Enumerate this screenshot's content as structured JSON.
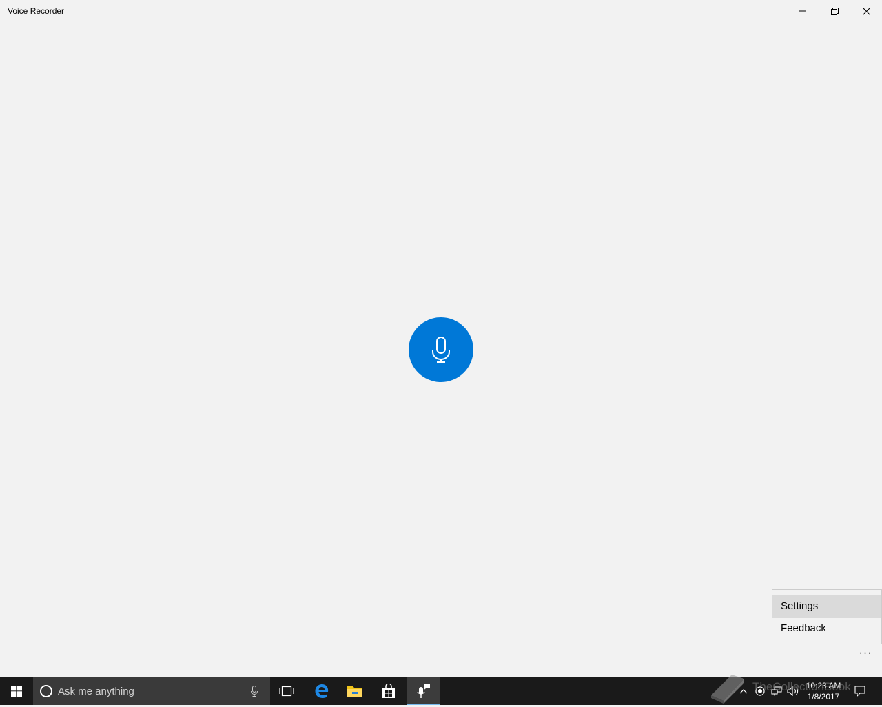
{
  "app": {
    "title": "Voice Recorder"
  },
  "window_controls": {
    "minimize": "minimize-icon",
    "maximize": "restore-icon",
    "close": "close-icon"
  },
  "record": {
    "icon": "microphone-icon",
    "accent": "#0078d7"
  },
  "menu": {
    "items": [
      {
        "label": "Settings"
      },
      {
        "label": "Feedback"
      }
    ]
  },
  "more": {
    "label": "···"
  },
  "taskbar": {
    "search_placeholder": "Ask me anything",
    "clock": {
      "time": "10:23 AM",
      "date": "1/8/2017"
    },
    "apps": [
      "task-view-icon",
      "edge-icon",
      "file-explorer-icon",
      "store-icon",
      "voice-recorder-icon"
    ]
  },
  "watermark": {
    "text": "TheCollectionBook"
  }
}
